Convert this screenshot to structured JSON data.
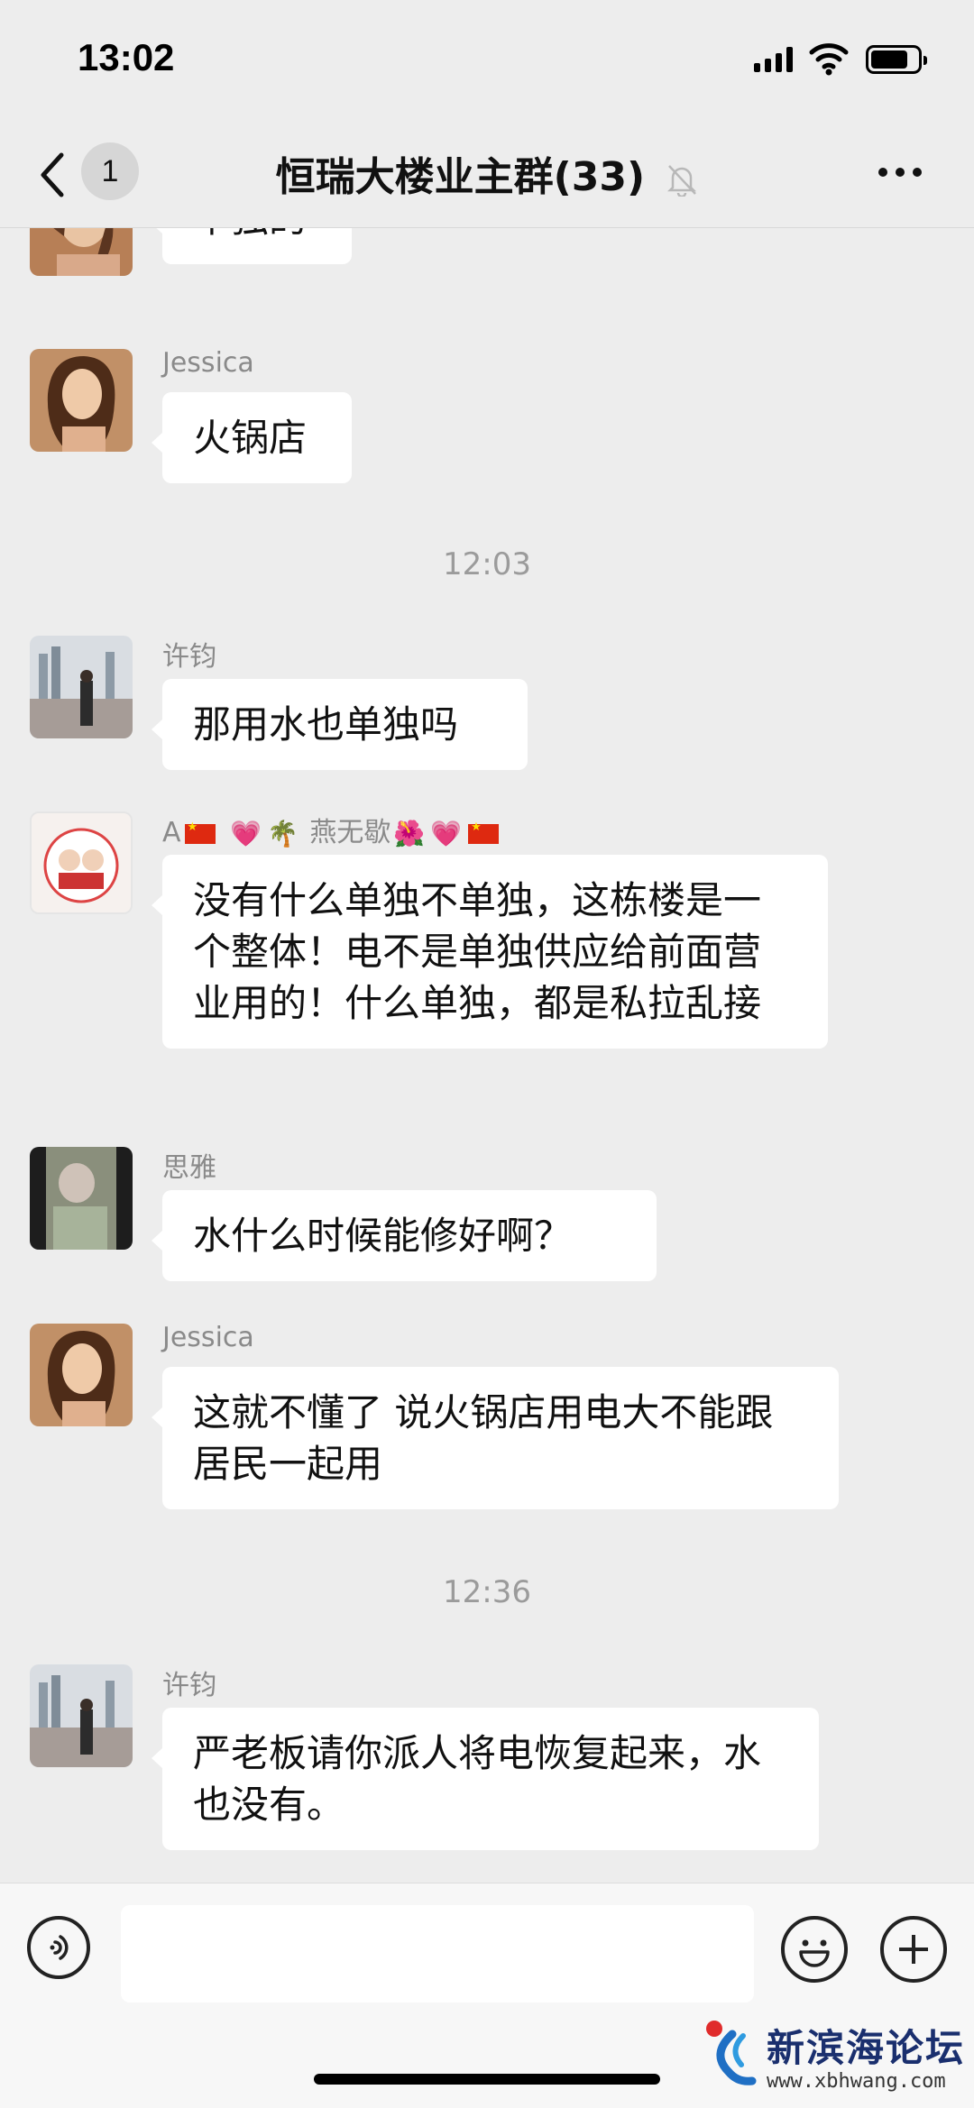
{
  "status_bar": {
    "time": "13:02",
    "battery_level": 0.8
  },
  "nav": {
    "unread_count": "1",
    "title": "恒瑞大楼业主群(33)"
  },
  "messages": [
    {
      "sender": "",
      "text": "单独的"
    },
    {
      "sender": "Jessica",
      "text": "火锅店"
    },
    {
      "sender": "许钧",
      "text": "那用水也单独吗"
    },
    {
      "sender_prefix": "A",
      "sender_name": "燕无歇",
      "text": "没有什么单独不单独，这栋楼是一个整体！电不是单独供应给前面营业用的！什么单独，都是私拉乱接"
    },
    {
      "sender": "思雅",
      "text": "水什么时候能修好啊？"
    },
    {
      "sender": "Jessica",
      "text": "这就不懂了 说火锅店用电大不能跟居民一起用"
    },
    {
      "sender": "许钧",
      "text": "严老板请你派人将电恢复起来，水也没有。"
    }
  ],
  "timestamps": [
    "12:03",
    "12:36"
  ],
  "input_bar": {
    "text": ""
  },
  "watermark": {
    "name": "新滨海论坛",
    "url": "www.xbhwang.com"
  }
}
